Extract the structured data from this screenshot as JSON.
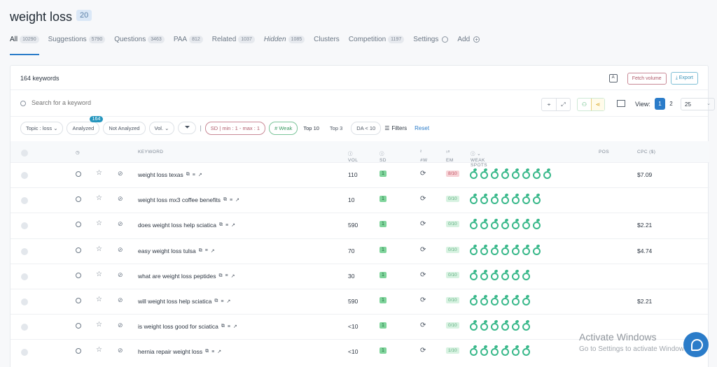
{
  "header": {
    "title": "weight loss",
    "badge": "20"
  },
  "tabs": [
    {
      "label": "All",
      "count": "10290"
    },
    {
      "label": "Suggestions",
      "count": "5790"
    },
    {
      "label": "Questions",
      "count": "3463"
    },
    {
      "label": "PAA",
      "count": "812"
    },
    {
      "label": "Related",
      "count": "1037"
    },
    {
      "label": "Hidden",
      "count": "1085"
    },
    {
      "label": "Clusters"
    },
    {
      "label": "Competition",
      "count": "1197"
    },
    {
      "label": "Settings"
    },
    {
      "label": "Add"
    }
  ],
  "panel": {
    "keyword_count": "164 keywords",
    "fetch_volume": "Fetch volume",
    "export": "Export",
    "search_placeholder": "Search for a keyword",
    "view_label": "View:",
    "pages": [
      "1",
      "2"
    ],
    "per_page": "25"
  },
  "filters": {
    "topic": "Topic : loss",
    "analyzed": "Analyzed",
    "analyzed_badge": "164",
    "not_analyzed": "Not Analyzed",
    "vol": "Vol.",
    "sd": "SD | min : 1 - max : 1",
    "weak": "# Weak",
    "top10": "Top 10",
    "top3": "Top 3",
    "da": "DA < 10",
    "filters": "Filters",
    "reset": "Reset"
  },
  "columns": {
    "keyword": "KEYWORD",
    "vol": "VOL",
    "sd": "SD",
    "w": "#W",
    "em": "EM",
    "weak_spots": "WEAK SPOTS",
    "pos": "POS",
    "cpc": "CPC ($)"
  },
  "rows": [
    {
      "keyword": "weight loss texas",
      "vol": "110",
      "sd": "1",
      "em": "8/10",
      "em_bad": true,
      "spots": 8,
      "cpc": "$7.09"
    },
    {
      "keyword": "weight loss mx3 coffee benefits",
      "vol": "10",
      "sd": "1",
      "em": "0/10",
      "spots": 7,
      "cpc": ""
    },
    {
      "keyword": "does weight loss help sciatica",
      "vol": "590",
      "sd": "1",
      "em": "0/10",
      "spots": 7,
      "cpc": "$2.21"
    },
    {
      "keyword": "easy weight loss tulsa",
      "vol": "70",
      "sd": "1",
      "em": "0/10",
      "spots": 7,
      "cpc": "$4.74"
    },
    {
      "keyword": "what are weight loss peptides",
      "vol": "30",
      "sd": "1",
      "em": "0/10",
      "spots": 6,
      "cpc": ""
    },
    {
      "keyword": "will weight loss help sciatica",
      "vol": "590",
      "sd": "1",
      "em": "0/10",
      "spots": 6,
      "cpc": "$2.21"
    },
    {
      "keyword": "is weight loss good for sciatica",
      "vol": "<10",
      "sd": "1",
      "em": "0/10",
      "spots": 6,
      "cpc": ""
    },
    {
      "keyword": "hernia repair weight loss",
      "vol": "<10",
      "sd": "1",
      "em": "1/10",
      "spots": 6,
      "cpc": ""
    }
  ],
  "windows_overlay": {
    "title": "Activate Windows",
    "subtitle": "Go to Settings to activate Windows."
  },
  "colors": {
    "accent": "#2b7cc9",
    "weak_spot": "#38b88a",
    "sd_badge": "#7fd49b"
  }
}
